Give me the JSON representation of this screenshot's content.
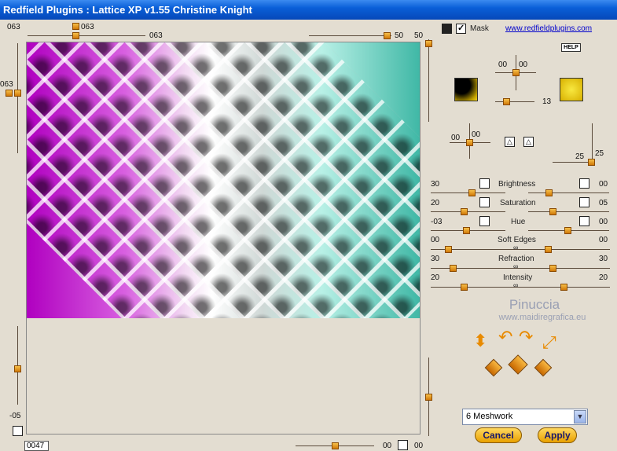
{
  "window": {
    "title": "Redfield Plugins : Lattice XP v1.55   Christine Knight"
  },
  "top_slider": {
    "label_left": "063",
    "label_knob": "063",
    "label_mid": "063",
    "right_value_a": "50",
    "right_value_b": "50"
  },
  "left_slider": {
    "top_value": "063",
    "bottom_value": "-05"
  },
  "mask": {
    "label": "Mask",
    "checked": true
  },
  "link": {
    "text": "www.redfieldplugins.com"
  },
  "help_label": "HELP",
  "light_position": {
    "x": "00",
    "y": "00",
    "value": "13"
  },
  "swatches": {
    "left_color": "#000000",
    "right_color": "#f0d020"
  },
  "secondary_position": {
    "x": "00",
    "y": "00"
  },
  "depth": {
    "value_a": "25",
    "value_b": "25"
  },
  "params": [
    {
      "label": "Brightness",
      "left": "30",
      "right": "00"
    },
    {
      "label": "Saturation",
      "left": "20",
      "right": "05"
    },
    {
      "label": "Hue",
      "left": "-03",
      "right": "00"
    },
    {
      "label": "Soft Edges",
      "left": "00",
      "right": "00"
    },
    {
      "label": "Refraction",
      "left": "30",
      "right": "30"
    },
    {
      "label": "Intensity",
      "left": "20",
      "right": "20"
    }
  ],
  "watermark": {
    "title": "Pinuccia",
    "url": "www.maidiregrafica.eu"
  },
  "preset": {
    "selected": "6 Meshwork"
  },
  "buttons": {
    "cancel": "Cancel",
    "apply": "Apply"
  },
  "bottom": {
    "status": "0047",
    "value": "00",
    "right_value": "00"
  }
}
